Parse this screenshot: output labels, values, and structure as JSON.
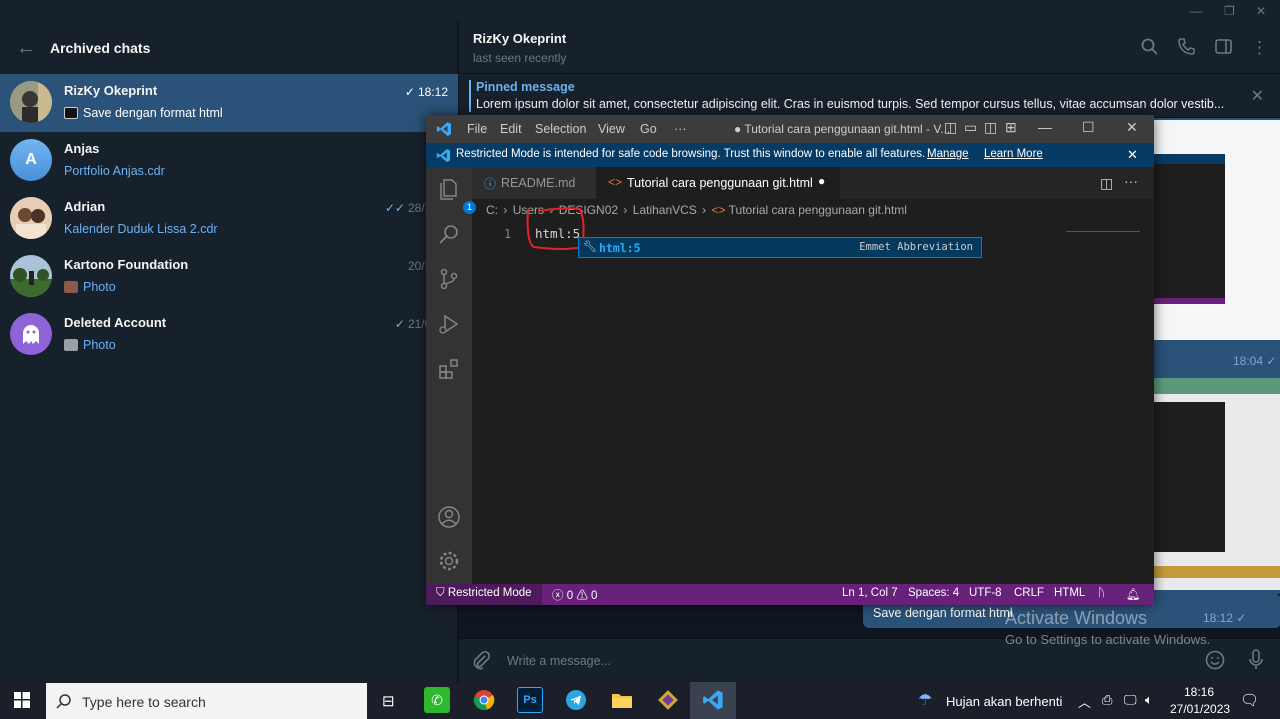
{
  "telegram": {
    "sidebar": {
      "title": "Archived chats",
      "chats": [
        {
          "name": "RizKy Okeprint",
          "preview": "Save dengan format html",
          "time": "18:12",
          "read": true
        },
        {
          "name": "Anjas",
          "preview": "Portfolio Anjas.cdr",
          "time": "",
          "read": true,
          "avatar_letter": "A"
        },
        {
          "name": "Adrian",
          "preview": "Kalender Duduk Lissa 2.cdr",
          "time": "28/12/2",
          "read": true
        },
        {
          "name": "Kartono Foundation",
          "preview": "Photo",
          "time": "20/10/2",
          "read": false
        },
        {
          "name": "Deleted Account",
          "preview": "Photo",
          "time": "21/07/2",
          "read": true
        }
      ]
    },
    "header": {
      "name": "RizKy Okeprint",
      "status": "last seen recently"
    },
    "pinned": {
      "title": "Pinned message",
      "text": "Lorem ipsum dolor sit amet, consectetur adipiscing elit. Cras in euismod turpis. Sed tempor cursus tellus, vitae accumsan dolor vestib..."
    },
    "messages": {
      "photo1_time": "18:04",
      "caption": "Save dengan format html",
      "caption_time": "18:12"
    },
    "input_placeholder": "Write a message...",
    "watermark": {
      "title": "Activate Windows",
      "subtitle": "Go to Settings to activate Windows."
    }
  },
  "vscode": {
    "menu": [
      "File",
      "Edit",
      "Selection",
      "View",
      "Go",
      "···"
    ],
    "window_title": "● Tutorial cara penggunaan git.html - V...",
    "banner": {
      "text": "Restricted Mode is intended for safe code browsing. Trust this window to enable all features.",
      "manage": "Manage",
      "learn_more": "Learn More"
    },
    "tabs": [
      {
        "label": "README.md",
        "active": false
      },
      {
        "label": "Tutorial cara penggunaan git.html",
        "active": true,
        "modified": true
      }
    ],
    "breadcrumb": [
      "C:",
      "Users",
      "DESIGN02",
      "LatihanVCS",
      "Tutorial cara penggunaan git.html"
    ],
    "line_number": "1",
    "code": "html:5",
    "suggestion": {
      "label": "html:5",
      "detail": "Emmet Abbreviation"
    },
    "explorer_badge": "1",
    "status": {
      "mode": "Restricted Mode",
      "errors": "0",
      "warnings": "0",
      "position": "Ln 1, Col 7",
      "spaces": "Spaces: 4",
      "encoding": "UTF-8",
      "eol": "CRLF",
      "language": "HTML"
    }
  },
  "taskbar": {
    "search_placeholder": "Type here to search",
    "weather": "Hujan akan berhenti",
    "time": "18:16",
    "date": "27/01/2023"
  }
}
